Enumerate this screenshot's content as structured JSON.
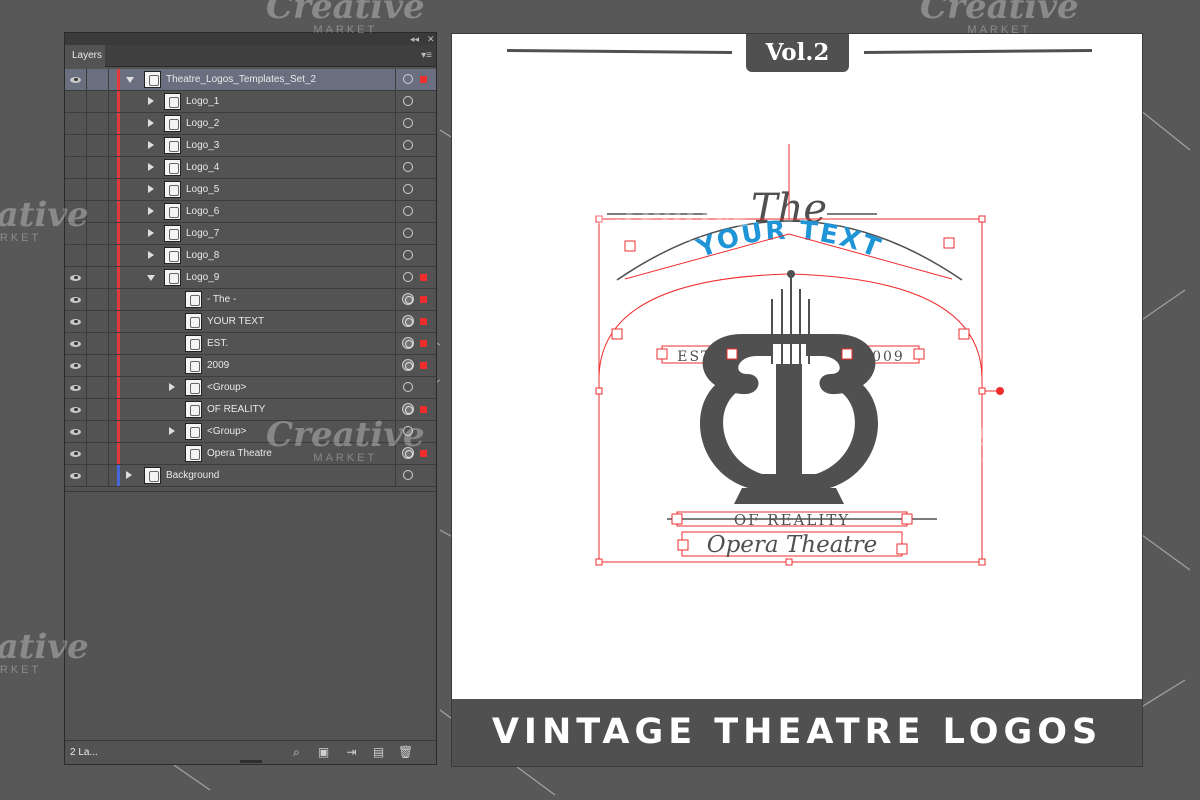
{
  "watermark": {
    "brand": "Creative",
    "sub": "MARKET"
  },
  "panel": {
    "tab": "Layers",
    "collapse_icon": "double-chevron-left",
    "close_icon": "close",
    "menu_icon": "panel-menu",
    "layer_count": "2 La...",
    "layers": [
      {
        "name": "Theatre_Logos_Templates_Set_2",
        "visible": true,
        "expanded": true,
        "selected": true
      },
      {
        "name": "Logo_1"
      },
      {
        "name": "Logo_2"
      },
      {
        "name": "Logo_3"
      },
      {
        "name": "Logo_4"
      },
      {
        "name": "Logo_5"
      },
      {
        "name": "Logo_6"
      },
      {
        "name": "Logo_7"
      },
      {
        "name": "Logo_8"
      },
      {
        "name": "Logo_9",
        "visible": true,
        "expanded": true
      },
      {
        "name": "- The -"
      },
      {
        "name": "YOUR TEXT"
      },
      {
        "name": "EST."
      },
      {
        "name": "2009"
      },
      {
        "name": "<Group>"
      },
      {
        "name": "OF REALITY"
      },
      {
        "name": "<Group>"
      },
      {
        "name": "Opera Theatre"
      },
      {
        "name": "Background",
        "visible": true
      }
    ],
    "footer_icons": [
      "search-icon",
      "make-clipping-mask-icon",
      "create-sublayer-icon",
      "create-new-layer-icon",
      "trash-icon"
    ]
  },
  "artboard": {
    "volume": "Vol.2",
    "logo": {
      "the": "The",
      "your_text": "YOUR TEXT",
      "est": "EST.",
      "year": "2009",
      "of_reality": "OF REALITY",
      "opera_theatre": "Opera Theatre"
    },
    "banner": "VINTAGE THEATRE LOGOS"
  },
  "colors": {
    "selection": "#ef2d2d",
    "accent_blue": "#1f95d8",
    "layer_red": "#e23a3a",
    "layer_blue": "#4766d8",
    "banner": "#505050"
  }
}
